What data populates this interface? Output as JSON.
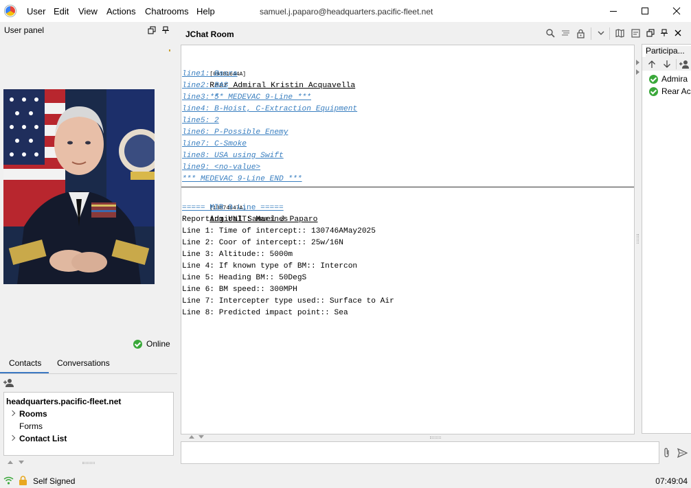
{
  "menu": {
    "items": [
      "User",
      "Edit",
      "View",
      "Actions",
      "Chatrooms",
      "Help"
    ]
  },
  "window": {
    "title": "samuel.j.paparo@headquarters.pacific-fleet.net"
  },
  "left_panel": {
    "title": "User panel",
    "status": "Online",
    "tabs": [
      "Contacts",
      "Conversations"
    ],
    "tree": {
      "server": "headquarters.pacific-fleet.net",
      "items": [
        {
          "label": "Rooms",
          "expandable": true,
          "bold": true
        },
        {
          "label": "Forms",
          "expandable": false,
          "bold": false
        },
        {
          "label": "Contact List",
          "expandable": true,
          "bold": true
        }
      ]
    }
  },
  "chat": {
    "room_title": "JChat Room",
    "messages": [
      {
        "timestamp": "[09181644A]",
        "sender": "Rear Admiral Kristin Acquavella",
        "header_link": "*** MEDEVAC 9-Line ***",
        "lines": [
          "line1: Basra",
          "line2: BAS",
          "line3: 5",
          "line4: B-Hoist, C-Extraction Equipment",
          "line5: 2",
          "line6: P-Possible Enemy",
          "line7: C-Smoke",
          "line8: USA using Swift",
          "line9: <no-value>",
          "*** MEDEVAC 9-Line END ***"
        ]
      },
      {
        "timestamp": "[13074847A]",
        "sender": "Admiral Samuel J Paparo",
        "header_link": "===== MIR 9-Line =====",
        "lines": [
          "Reporting UNIT: Marines",
          "Line 1: Time of intercept:: 130746AMay2025",
          "Line 2: Coor of intercept:: 25w/16N",
          "Line 3: Altitude:: 5000m",
          "Line 4: If known type of BM:: Intercon",
          "Line 5: Heading BM:: 50DegS",
          "Line 6: BM speed:: 300MPH",
          "Line 7: Intercepter type used:: Surface to Air",
          "Line 8: Predicted impact point:: Sea"
        ]
      }
    ],
    "input_value": ""
  },
  "participants": {
    "title": "Participa...",
    "members": [
      "Admiral Samuel J Paparo",
      "Rear Admiral Kristin Acquavella"
    ],
    "visible_labels": [
      "Admira",
      "Rear Ac"
    ]
  },
  "statusbar": {
    "certificate": "Self Signed",
    "clock": "07:49:04"
  },
  "colors": {
    "link": "#3a7fc0",
    "online": "#3aa83a",
    "tab_underline": "#3a78c2"
  }
}
